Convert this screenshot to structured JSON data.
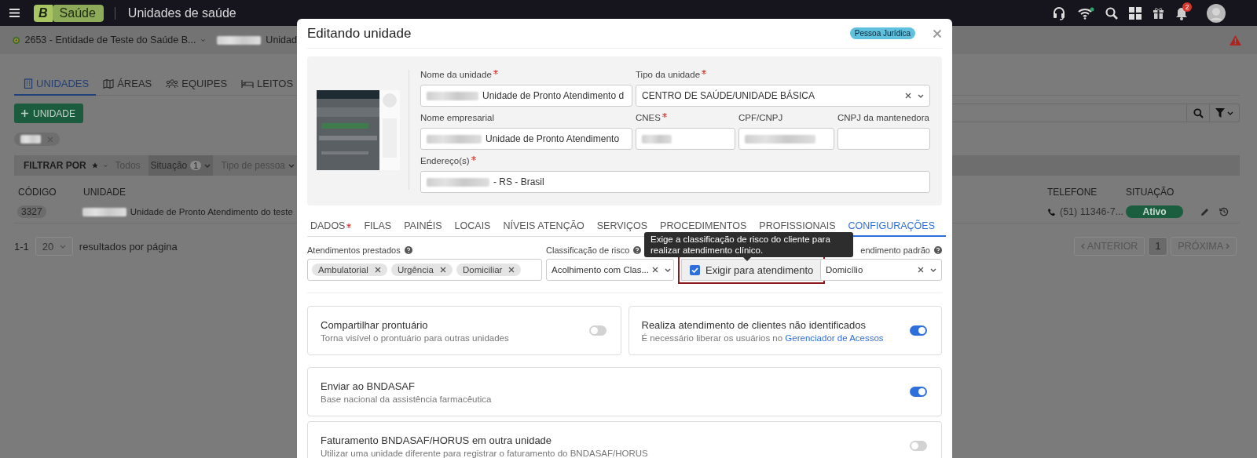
{
  "top_bar": {
    "logo_letter": "B",
    "app_name": "Saúde",
    "page_title": "Unidades de saúde",
    "notification_count": "2"
  },
  "context_bar": {
    "entity": "2653 - Entidade de Teste do Saúde B...",
    "unit": "Unidad"
  },
  "section_tabs": [
    {
      "label": "UNIDADES",
      "selected": true
    },
    {
      "label": "ÁREAS",
      "selected": false
    },
    {
      "label": "EQUIPES",
      "selected": false
    },
    {
      "label": "LEITOS",
      "selected": false
    }
  ],
  "add_button": "UNIDADE",
  "filter_bar": {
    "label": "FILTRAR POR",
    "filters": [
      {
        "label": "Todos",
        "selected": false,
        "dropdown": false
      },
      {
        "label": "Situação",
        "count": "1",
        "selected": true,
        "dropdown": true
      },
      {
        "label": "Tipo de pessoa",
        "selected": false,
        "dropdown": true
      }
    ]
  },
  "table": {
    "columns": [
      "CÓDIGO",
      "UNIDADE",
      "TELEFONE",
      "SITUAÇÃO"
    ],
    "rows": [
      {
        "code": "3327",
        "unit": "Unidade de Pronto Atendimento do teste",
        "phone": "(51) 11346-7...",
        "status": "Ativo"
      }
    ]
  },
  "pagination": {
    "range": "1-1",
    "page_size": "20",
    "page_size_label": "resultados por página",
    "previous": "ANTERIOR",
    "pages": [
      {
        "label": "1",
        "selected": true
      }
    ],
    "next": "PRÓXIMA"
  },
  "modal": {
    "title": "Editando unidade",
    "badge": "Pessoa Jurídica",
    "fields": [
      {
        "label": "Nome da unidade",
        "required": true,
        "kind": "text",
        "value": "Unidade de Pronto Atendimento d",
        "redacted": true
      },
      {
        "label": "Tipo da unidade",
        "required": true,
        "kind": "select",
        "value": "CENTRO DE SAÚDE/UNIDADE BÁSICA",
        "redacted": false
      },
      {
        "label": "Nome empresarial",
        "required": false,
        "kind": "text",
        "value": "Unidade de Pronto Atendimento",
        "redacted": true
      },
      {
        "label": "CNES",
        "required": true,
        "kind": "text",
        "redacted": true
      },
      {
        "label": "CPF/CNPJ",
        "required": false,
        "kind": "text",
        "redacted": true
      },
      {
        "label": "CNPJ da mantenedora",
        "required": false,
        "kind": "text",
        "redacted": false
      },
      {
        "label": "Endereço(s)",
        "required": true,
        "kind": "text",
        "value": "- RS - Brasil",
        "redacted": true
      }
    ],
    "tabs": [
      {
        "label": "DADOS",
        "required": true,
        "selected": false
      },
      {
        "label": "FILAS",
        "required": false,
        "selected": false
      },
      {
        "label": "PAINÉIS",
        "required": false,
        "selected": false
      },
      {
        "label": "LOCAIS",
        "required": false,
        "selected": false
      },
      {
        "label": "NÍVEIS ATENÇÃO",
        "required": false,
        "selected": false
      },
      {
        "label": "SERVIÇOS",
        "required": false,
        "selected": false
      },
      {
        "label": "PROCEDIMENTOS",
        "required": false,
        "selected": false
      },
      {
        "label": "PROFISSIONAIS",
        "required": false,
        "selected": false
      },
      {
        "label": "CONFIGURAÇÕES",
        "required": false,
        "selected": true
      }
    ],
    "settings": [
      {
        "kind": "multiselect",
        "label": "Atendimentos prestados",
        "help": true,
        "chips": [
          "Ambulatorial",
          "Urgência",
          "Domiciliar"
        ]
      },
      {
        "kind": "select",
        "label": "Classificação de risco",
        "help": true,
        "value": "Acolhimento com Clas..."
      },
      {
        "kind": "checkbox",
        "label": "Exigir para atendimento",
        "checked": true,
        "highlighted": true
      },
      {
        "kind": "select",
        "label": "endimento padrão",
        "help": true,
        "value": "Domicílio"
      }
    ],
    "tooltip": "Exige a classificação de risco do cliente para realizar atendimento clínico.",
    "cards": [
      {
        "title": "Compartilhar prontuário",
        "description": "Torna visível o prontuário para outras unidades",
        "on": false
      },
      {
        "title": "Realiza atendimento de clientes não identificados",
        "description": "É necessário liberar os usuários no",
        "link": "Gerenciador de Acessos",
        "on": true
      },
      {
        "title": "Enviar ao BNDASAF",
        "description": "Base nacional da assistência farmacêutica",
        "on": true
      },
      {
        "title": "Faturamento BNDASAF/HORUS em outra unidade",
        "description": "Utilizar uma unidade diferente para registrar o faturamento do BNDASAF/HORUS",
        "on": false
      }
    ]
  }
}
